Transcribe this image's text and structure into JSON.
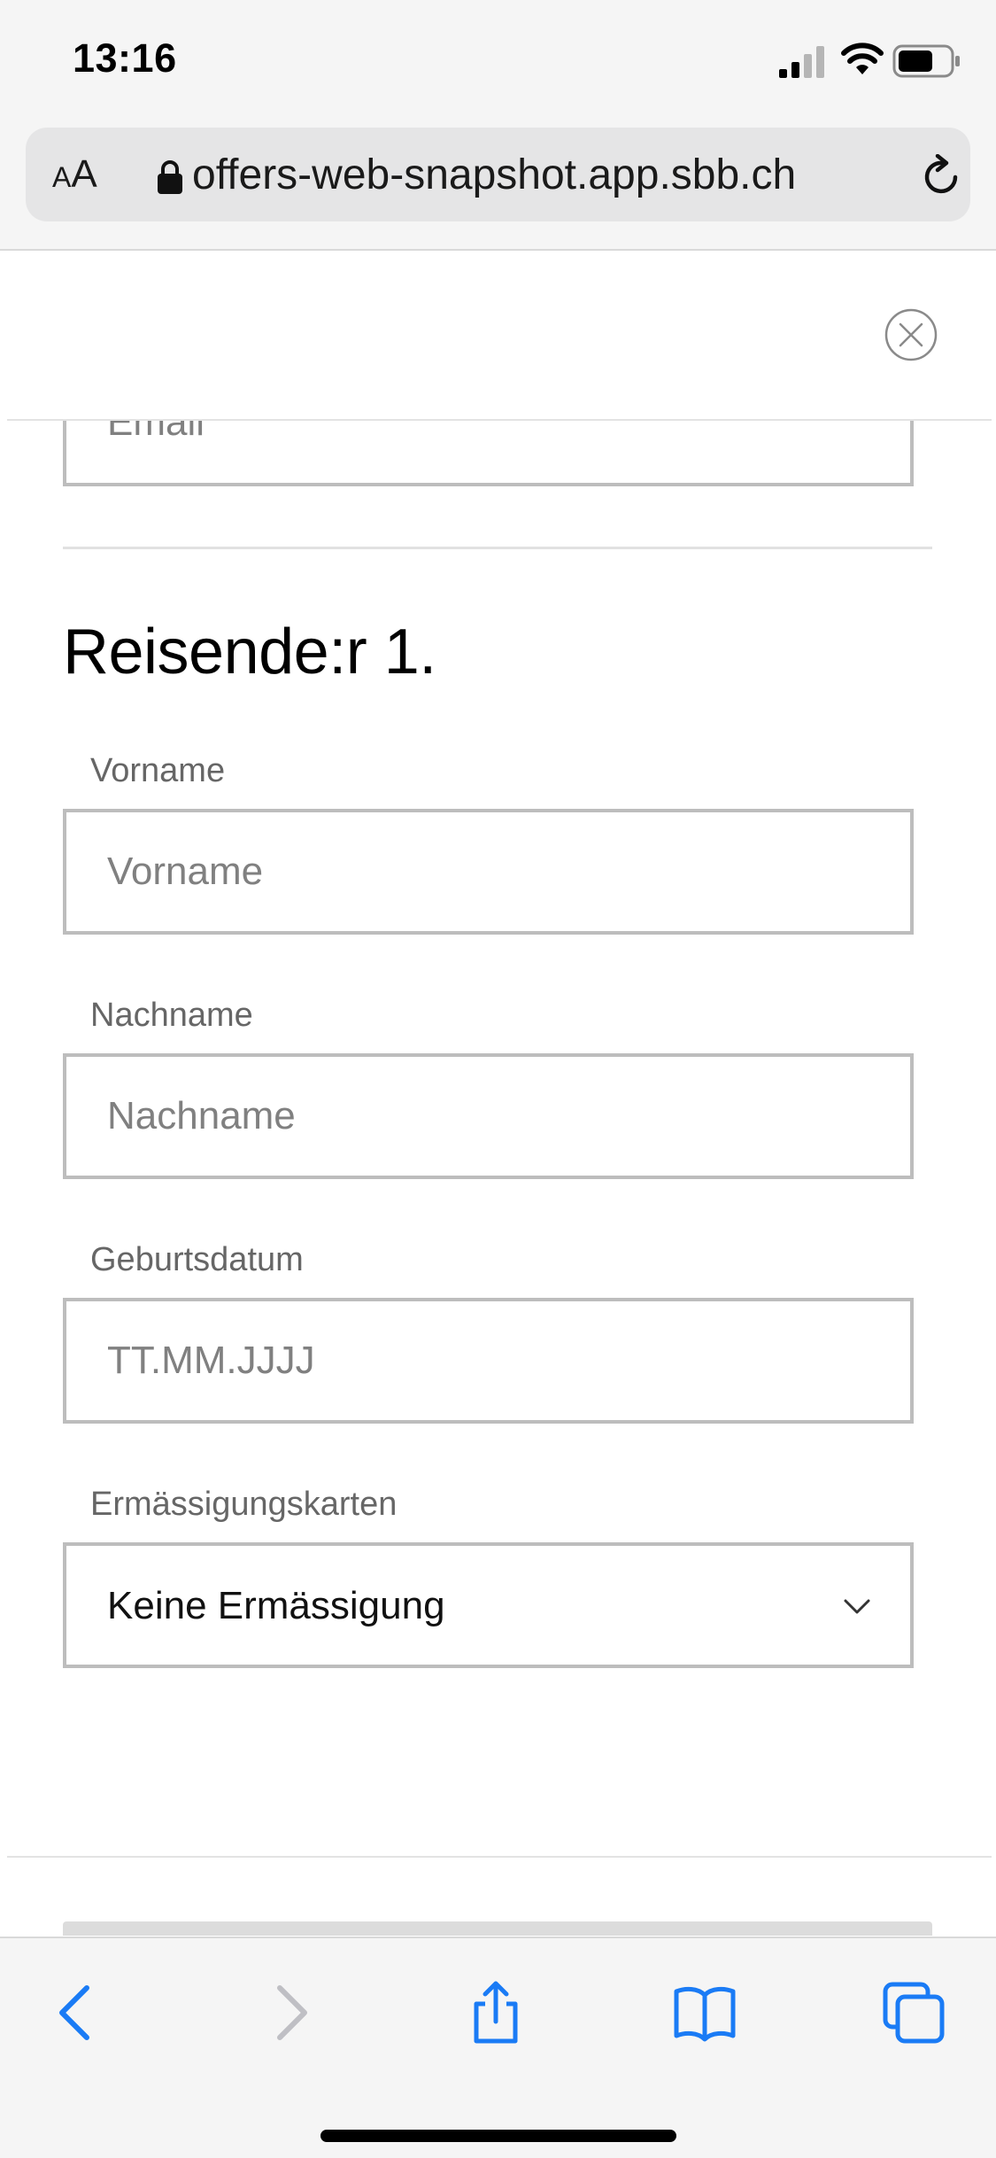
{
  "status_bar": {
    "time": "13:16"
  },
  "address_bar": {
    "text_size_label_small": "A",
    "text_size_label_large": "A",
    "url": "offers-web-snapshot.app.sbb.ch"
  },
  "form": {
    "email_placeholder": "Email",
    "section_title": "Reisende:r 1.",
    "first_name": {
      "label": "Vorname",
      "placeholder": "Vorname"
    },
    "last_name": {
      "label": "Nachname",
      "placeholder": "Nachname"
    },
    "birthdate": {
      "label": "Geburtsdatum",
      "placeholder": "TT.MM.JJJJ"
    },
    "discount_card": {
      "label": "Ermässigungskarten",
      "selected": "Keine Ermässigung"
    }
  },
  "colors": {
    "toolbar_accent": "#1a7bf5",
    "toolbar_disabled": "#bfbfc4",
    "field_border": "#bdbdbd"
  },
  "icons": [
    "signal-icon",
    "wifi-icon",
    "battery-icon",
    "lock-icon",
    "reload-icon",
    "close-icon",
    "chevron-down-icon",
    "back-icon",
    "forward-icon",
    "share-icon",
    "bookmarks-icon",
    "tabs-icon"
  ]
}
